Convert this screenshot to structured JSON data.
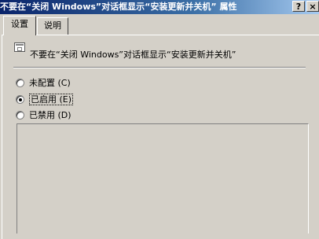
{
  "window": {
    "title": "不要在“关闭 Windows”对话框显示“安装更新并关机” 属性",
    "help_button": "?",
    "close_button": "×"
  },
  "tabs": [
    {
      "label": "设置",
      "active": true
    },
    {
      "label": "说明",
      "active": false
    }
  ],
  "policy": {
    "icon": "policy-setting-icon",
    "name": "不要在“关闭 Windows”对话框显示“安装更新并关机”"
  },
  "options": [
    {
      "label": "未配置 (C)",
      "checked": false
    },
    {
      "label": "已启用 (E)",
      "checked": true
    },
    {
      "label": "已禁用 (D)",
      "checked": false
    }
  ]
}
